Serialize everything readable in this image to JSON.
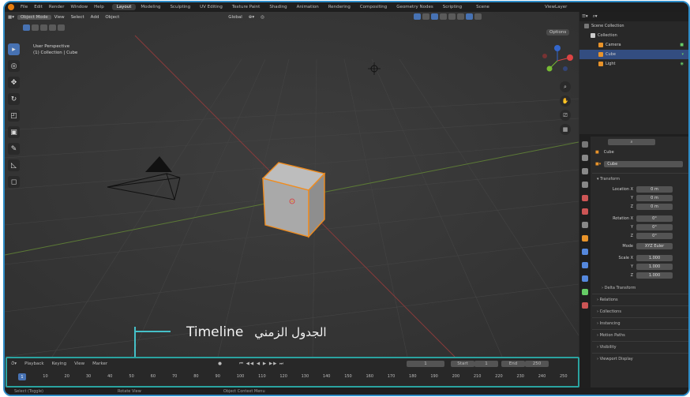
{
  "topbar": {
    "menus": [
      "File",
      "Edit",
      "Render",
      "Window",
      "Help"
    ],
    "workspaces": [
      "Layout",
      "Modeling",
      "Sculpting",
      "UV Editing",
      "Texture Paint",
      "Shading",
      "Animation",
      "Rendering",
      "Compositing",
      "Geometry Nodes",
      "Scripting"
    ],
    "active_workspace": "Layout",
    "scene_label": "Scene",
    "viewlayer_label": "ViewLayer"
  },
  "viewport": {
    "mode": "Object Mode",
    "menus": [
      "View",
      "Select",
      "Add",
      "Object"
    ],
    "transform_orientation": "Global",
    "options_label": "Options",
    "info_line1": "User Perspective",
    "info_line2": "(1) Collection | Cube"
  },
  "outliner": {
    "rows": [
      {
        "label": "Scene Collection",
        "color": "#cfcfcf"
      },
      {
        "label": "Collection",
        "color": "#cfcfcf"
      },
      {
        "label": "Camera",
        "color": "#e8932a"
      },
      {
        "label": "Cube",
        "color": "#e8932a",
        "selected": true
      },
      {
        "label": "Light",
        "color": "#e8932a"
      }
    ]
  },
  "properties": {
    "object_name": "Cube",
    "mesh_name": "Cube",
    "transform_label": "Transform",
    "location_label": "Location X",
    "location_values": [
      "0 m",
      "0 m",
      "0 m"
    ],
    "rotation_label": "Rotation X",
    "rotation_values": [
      "0°",
      "0°",
      "0°"
    ],
    "mode_label": "Mode",
    "mode_value": "XYZ Euler",
    "scale_label": "Scale X",
    "scale_values": [
      "1.000",
      "1.000",
      "1.000"
    ],
    "axis_y": "Y",
    "axis_z": "Z",
    "sections": [
      "Delta Transform",
      "Relations",
      "Collections",
      "Instancing",
      "Motion Paths",
      "Visibility",
      "Viewport Display"
    ]
  },
  "timeline": {
    "menus": [
      "Playback",
      "Keying",
      "View",
      "Marker"
    ],
    "current_frame": "1",
    "start_label": "Start",
    "start_value": "1",
    "end_label": "End",
    "end_value": "250",
    "ticks": [
      "1",
      "10",
      "20",
      "30",
      "40",
      "50",
      "60",
      "70",
      "80",
      "90",
      "100",
      "110",
      "120",
      "130",
      "140",
      "150",
      "160",
      "170",
      "180",
      "190",
      "200",
      "210",
      "220",
      "230",
      "240",
      "250"
    ]
  },
  "callout": {
    "english": "Timeline",
    "arabic": "الجدول الزمني"
  },
  "statusbar": {
    "items": [
      "Select (Toggle)",
      "Rotate View",
      "Object Context Menu"
    ]
  },
  "colors": {
    "accent_blue": "#4772b3",
    "selection_orange": "#e8932a",
    "timeline_highlight": "#2aa3a0",
    "frame_border": "#2d8cc7"
  }
}
